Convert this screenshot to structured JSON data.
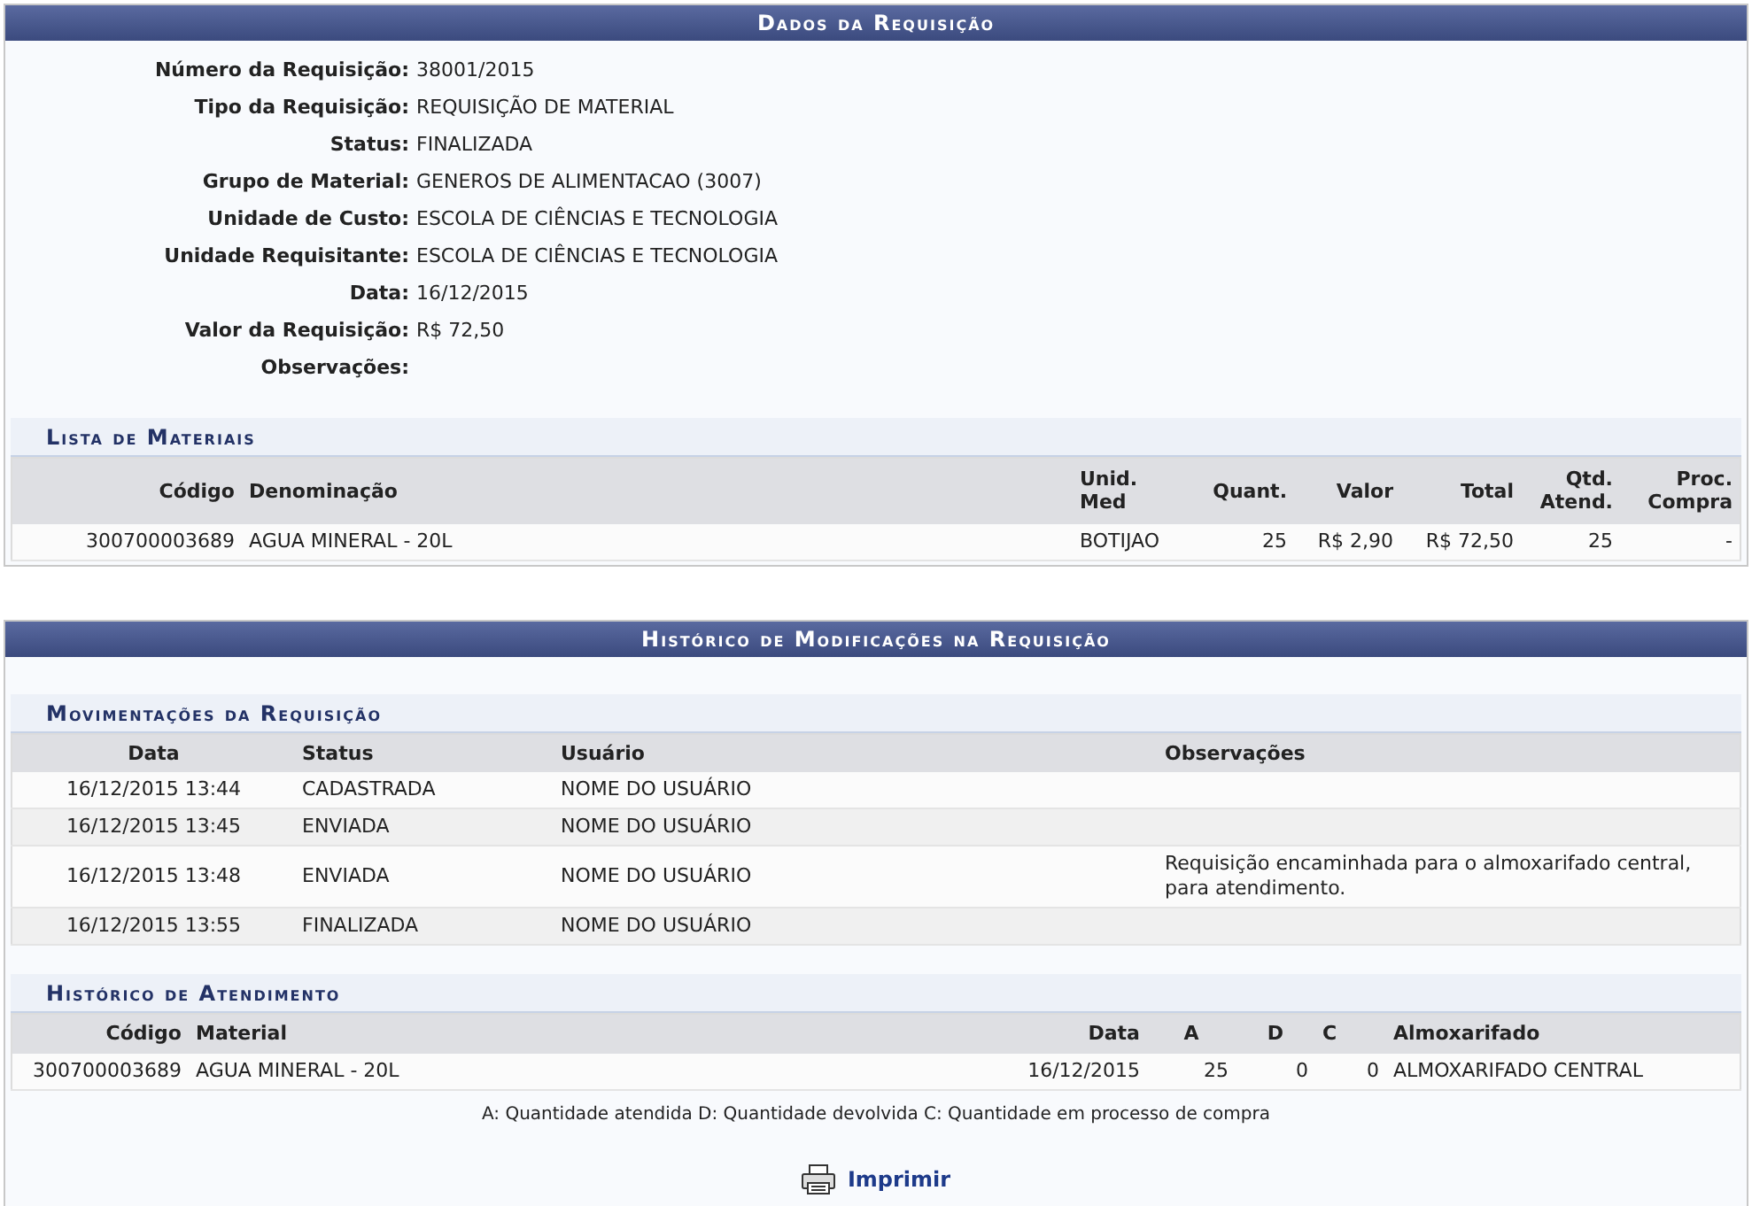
{
  "dados": {
    "title": "Dados da Requisição",
    "fields": [
      {
        "label": "Número da Requisição:",
        "value": "38001/2015"
      },
      {
        "label": "Tipo da Requisição:",
        "value": "REQUISIÇÃO DE MATERIAL"
      },
      {
        "label": "Status:",
        "value": "FINALIZADA"
      },
      {
        "label": "Grupo de Material:",
        "value": "GENEROS DE ALIMENTACAO (3007)"
      },
      {
        "label": "Unidade de Custo:",
        "value": "ESCOLA DE CIÊNCIAS E TECNOLOGIA"
      },
      {
        "label": "Unidade Requisitante:",
        "value": "ESCOLA DE CIÊNCIAS E TECNOLOGIA"
      },
      {
        "label": "Data:",
        "value": "16/12/2015"
      },
      {
        "label": "Valor da Requisição:",
        "value": "R$ 72,50"
      },
      {
        "label": "Observações:"
      }
    ],
    "materiais": {
      "title": "Lista de Materiais",
      "columns": [
        "Código",
        "Denominação",
        "Unid. Med",
        "Quant.",
        "Valor",
        "Total",
        "Qtd. Atend.",
        "Proc. Compra"
      ],
      "rows": [
        [
          "300700003689",
          "AGUA MINERAL - 20L",
          "BOTIJAO",
          "25",
          "R$ 2,90",
          "R$ 72,50",
          "25",
          "-"
        ]
      ]
    }
  },
  "historico": {
    "title": "Histórico de Modificações na Requisição",
    "movimentacoes": {
      "title": "Movimentações da Requisição",
      "columns": [
        "Data",
        "Status",
        "Usuário",
        "Observações"
      ],
      "rows": [
        [
          "16/12/2015 13:44",
          "CADASTRADA",
          "NOME DO USUÁRIO",
          ""
        ],
        [
          "16/12/2015 13:45",
          "ENVIADA",
          "NOME DO USUÁRIO",
          ""
        ],
        [
          "16/12/2015 13:48",
          "ENVIADA",
          "NOME DO USUÁRIO",
          "Requisição encaminhada para o almoxarifado central, para atendimento."
        ],
        [
          "16/12/2015 13:55",
          "FINALIZADA",
          "NOME DO USUÁRIO",
          ""
        ]
      ]
    },
    "atendimento": {
      "title": "Histórico de Atendimento",
      "columns": [
        "Código",
        "Material",
        "Data",
        "A",
        "D",
        "C",
        "Almoxarifado"
      ],
      "rows": [
        [
          "300700003689",
          "AGUA MINERAL - 20L",
          "16/12/2015",
          "25",
          "0",
          "0",
          "ALMOXARIFADO CENTRAL"
        ]
      ],
      "legend": "A: Quantidade atendida D: Quantidade devolvida C: Quantidade em processo de compra"
    },
    "print_link": "Imprimir"
  }
}
